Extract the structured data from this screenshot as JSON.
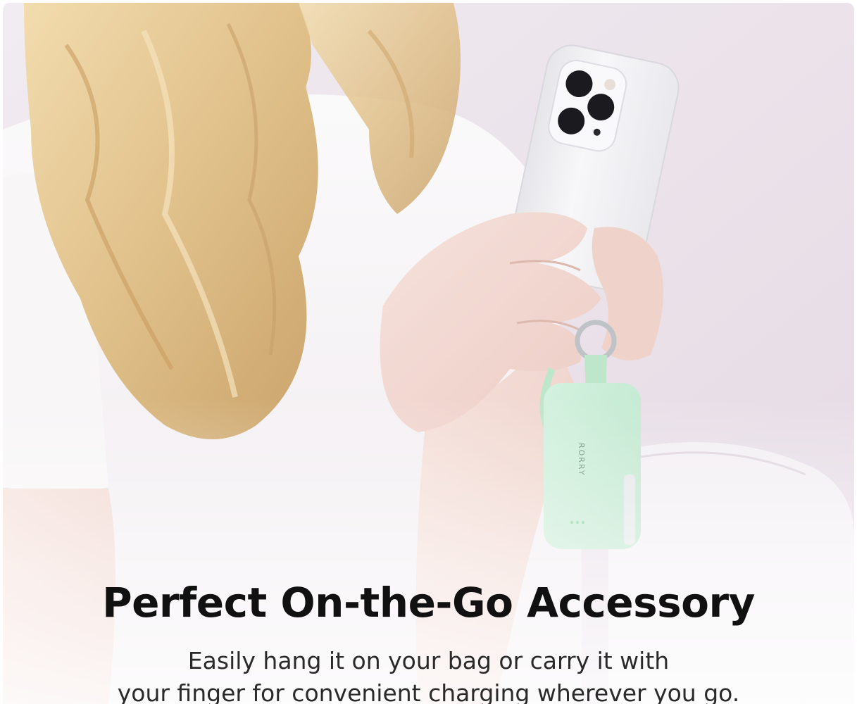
{
  "brand": "RORRY",
  "headline": "Perfect On-the-Go Accessory",
  "description": {
    "line1": "Easily hang it on your bag or carry it with",
    "line2": "your finger for convenient charging wherever you go."
  },
  "colors": {
    "background": "#ece3ec",
    "power_bank": "#c8ecd6",
    "shirt": "#f7f5f6",
    "phone": "#f2f2f4",
    "hair": "#e2c48f",
    "text": "#111111"
  }
}
